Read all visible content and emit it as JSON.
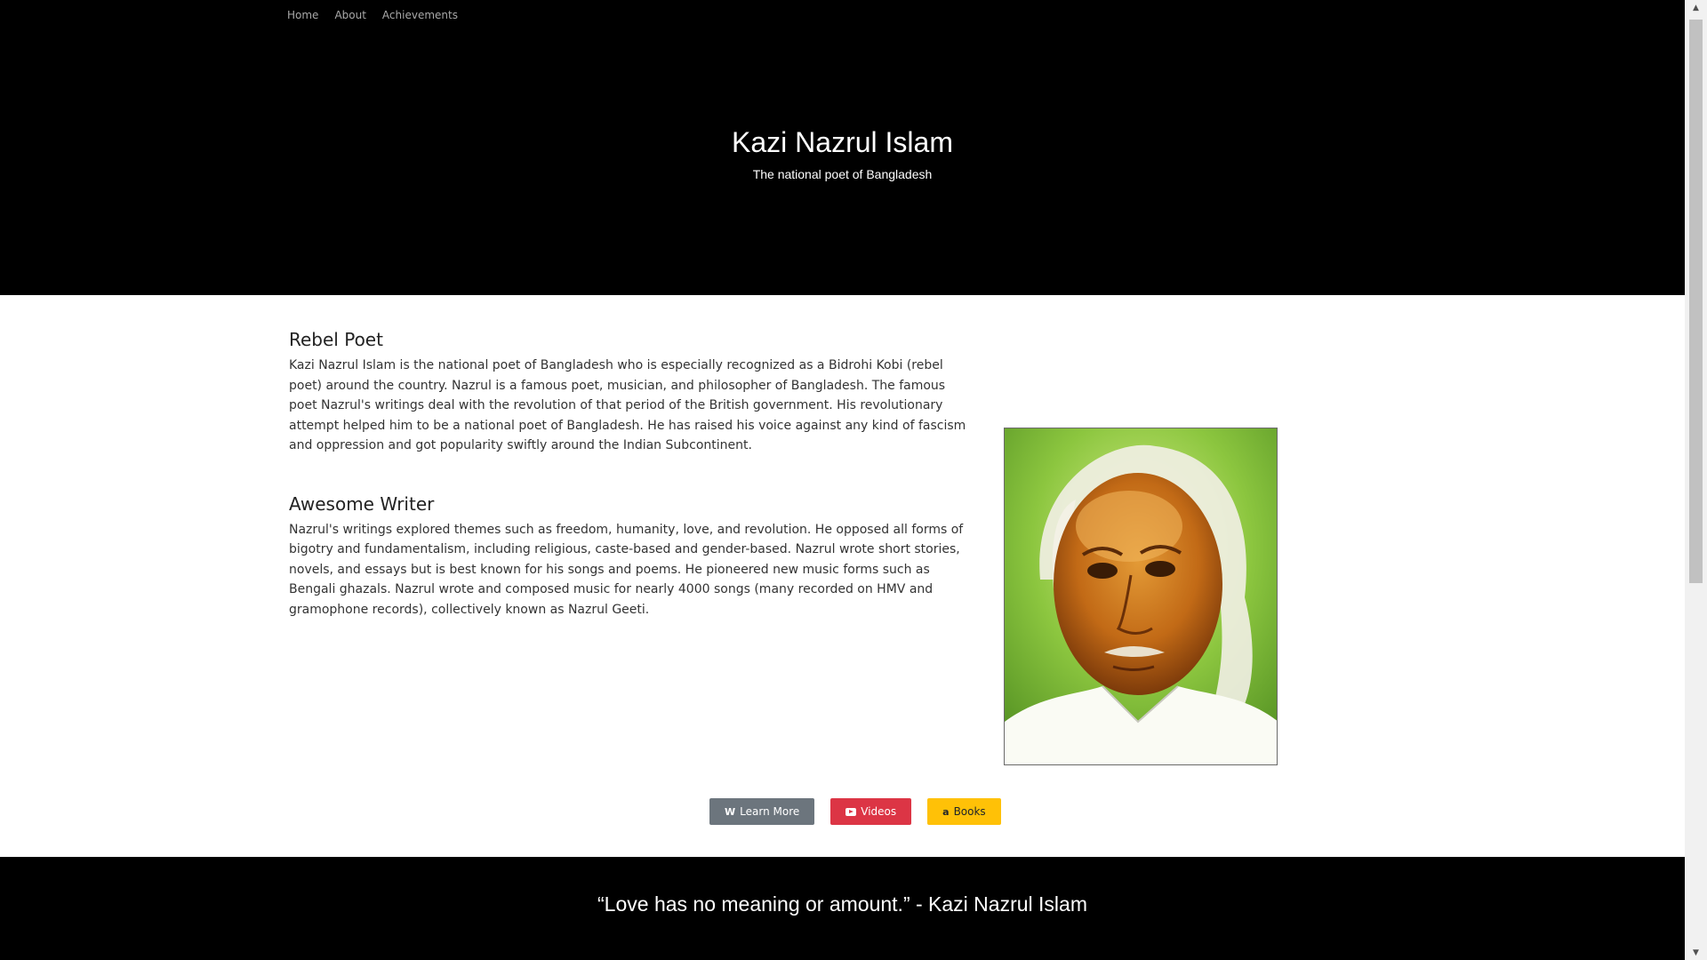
{
  "nav": {
    "items": [
      "Home",
      "About",
      "Achievements"
    ]
  },
  "hero": {
    "title": "Kazi Nazrul Islam",
    "subtitle": "The national poet of Bangladesh"
  },
  "sections": [
    {
      "title": "Rebel Poet",
      "body": "Kazi Nazrul Islam is the national poet of Bangladesh who is especially recognized as a Bidrohi Kobi (rebel poet) around the country. Nazrul is a famous poet, musician, and philosopher of Bangladesh. The famous poet Nazrul's writings deal with the revolution of that period of the British government. His revolutionary attempt helped him to be a national poet of Bangladesh. He has raised his voice against any kind of fascism and oppression and got popularity swiftly around the Indian Subcontinent."
    },
    {
      "title": "Awesome Writer",
      "body": "Nazrul's writings explored themes such as freedom, humanity, love, and revolution. He opposed all forms of bigotry and fundamentalism, including religious, caste-based and gender-based. Nazrul wrote short stories, novels, and essays but is best known for his songs and poems. He pioneered new music forms such as Bengali ghazals. Nazrul wrote and composed music for nearly 4000 songs (many recorded on HMV and gramophone records), collectively known as Nazrul Geeti."
    }
  ],
  "buttons": {
    "learn_more": {
      "label": "Learn More",
      "icon": "W"
    },
    "videos": {
      "label": "Videos",
      "icon": "youtube-icon"
    },
    "books": {
      "label": "Books",
      "icon": "a"
    }
  },
  "footer": {
    "quote": "“Love has no meaning or amount.” - Kazi Nazrul Islam"
  },
  "colors": {
    "header_bg": "#000000",
    "btn_grey": "#6c757d",
    "btn_red": "#dc3545",
    "btn_yellow": "#ffc107"
  }
}
